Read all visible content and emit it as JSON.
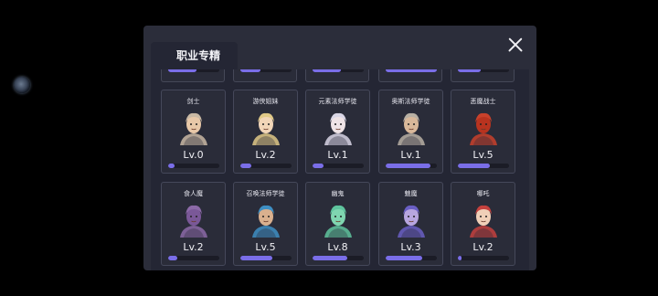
{
  "panel": {
    "title": "职业专精",
    "close_icon": "close-icon"
  },
  "partial_row": {
    "progress": [
      0.55,
      0.4,
      0.55,
      1.0,
      0.45
    ]
  },
  "cards": [
    {
      "name": "剑士",
      "level": "Lv.0",
      "progress": 0.12,
      "icon": "swordsman-portrait-icon",
      "color": "#c9b9a4"
    },
    {
      "name": "游侠姐妹",
      "level": "Lv.2",
      "progress": 0.22,
      "icon": "ranger-sisters-portrait-icon",
      "color": "#e0c987"
    },
    {
      "name": "元素法师学徒",
      "level": "Lv.1",
      "progress": 0.22,
      "icon": "elementalist-apprentice-portrait-icon",
      "color": "#d9d6e6"
    },
    {
      "name": "奥斯法师学徒",
      "level": "Lv.1",
      "progress": 0.88,
      "icon": "arcane-apprentice-portrait-icon",
      "color": "#b8b0a4"
    },
    {
      "name": "恶魔战士",
      "level": "Lv.5",
      "progress": 0.62,
      "icon": "demon-warrior-portrait-icon",
      "color": "#c8412b"
    },
    {
      "name": "食人魔",
      "level": "Lv.2",
      "progress": 0.18,
      "icon": "ogre-portrait-icon",
      "color": "#8c6aa8"
    },
    {
      "name": "召唤法师学徒",
      "level": "Lv.5",
      "progress": 0.62,
      "icon": "summoner-apprentice-portrait-icon",
      "color": "#3e8fc4"
    },
    {
      "name": "幽鬼",
      "level": "Lv.8",
      "progress": 0.68,
      "icon": "wraith-portrait-icon",
      "color": "#5fc49e"
    },
    {
      "name": "魅魔",
      "level": "Lv.3",
      "progress": 0.72,
      "icon": "succubus-portrait-icon",
      "color": "#6a5fc4"
    },
    {
      "name": "哪吒",
      "level": "Lv.2",
      "progress": 0.08,
      "icon": "nezha-portrait-icon",
      "color": "#c4413e"
    }
  ]
}
